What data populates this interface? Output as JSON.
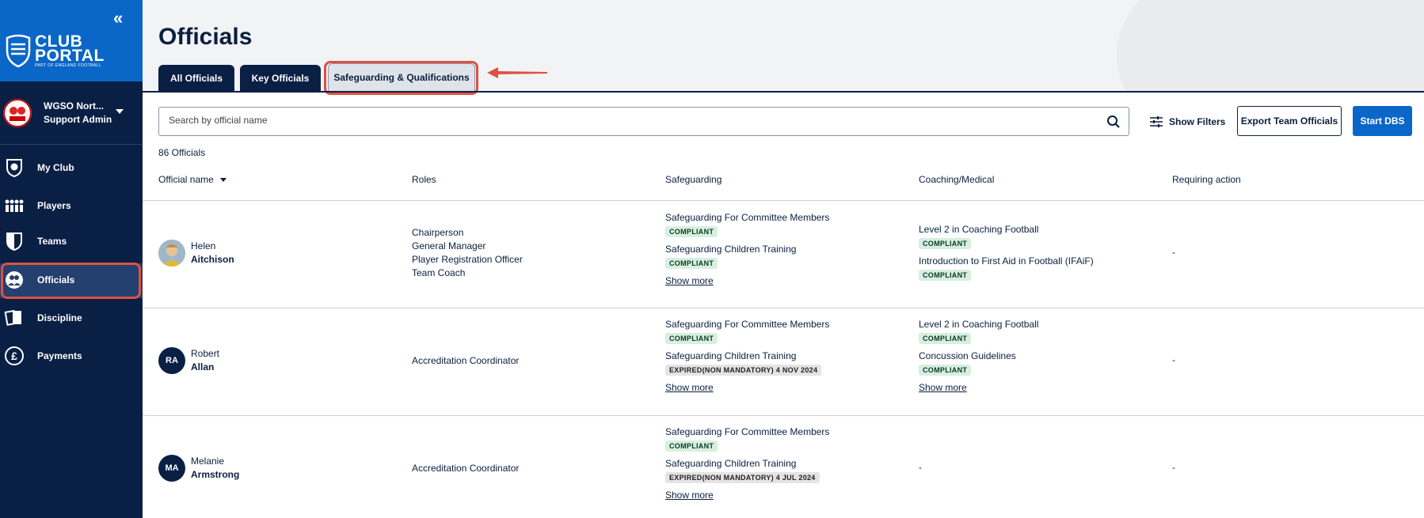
{
  "sidebar": {
    "collapse_label": "«",
    "brand_line1": "CLUB",
    "brand_line2": "PORTAL",
    "brand_sub": "PART OF ENGLAND FOOTBALL",
    "account_name": "WGSO Nort...",
    "account_role": "Support Admin",
    "items": [
      {
        "label": "My Club",
        "icon": "shield-ball-icon"
      },
      {
        "label": "Players",
        "icon": "players-icon"
      },
      {
        "label": "Teams",
        "icon": "team-shield-icon"
      },
      {
        "label": "Officials",
        "icon": "officials-icon",
        "active": true
      },
      {
        "label": "Discipline",
        "icon": "cards-icon"
      },
      {
        "label": "Payments",
        "icon": "pound-icon"
      }
    ]
  },
  "page": {
    "title": "Officials",
    "tabs": [
      "All Officials",
      "Key Officials",
      "Safeguarding & Qualifications"
    ],
    "active_tab": "Safeguarding & Qualifications",
    "search_placeholder": "Search by official name",
    "show_filters": "Show Filters",
    "export_label": "Export Team Officials",
    "dbs_label": "Start DBS",
    "count_label": "86 Officials"
  },
  "table": {
    "headers": [
      "Official name",
      "Roles",
      "Safeguarding",
      "Coaching/Medical",
      "Requiring action"
    ],
    "rows": [
      {
        "first": "Helen",
        "last": "Aitchison",
        "initials": "",
        "roles": [
          "Chairperson",
          "General Manager",
          "Player Registration Officer",
          "Team Coach"
        ],
        "safeguarding": [
          {
            "title": "Safeguarding For Committee Members",
            "status": "COMPLIANT"
          },
          {
            "title": "Safeguarding Children Training",
            "status": "COMPLIANT"
          }
        ],
        "safeguarding_more": "Show more",
        "coaching": [
          {
            "title": "Level 2 in Coaching Football",
            "status": "COMPLIANT"
          },
          {
            "title": "Introduction to First Aid in Football (IFAiF)",
            "status": "COMPLIANT"
          }
        ],
        "coaching_more": "",
        "requiring": "-"
      },
      {
        "first": "Robert",
        "last": "Allan",
        "initials": "RA",
        "roles": [
          "Accreditation Coordinator"
        ],
        "safeguarding": [
          {
            "title": "Safeguarding For Committee Members",
            "status": "COMPLIANT"
          },
          {
            "title": "Safeguarding Children Training",
            "status": "EXPIRED(NON MANDATORY) 4 NOV 2024"
          }
        ],
        "safeguarding_more": "Show more",
        "coaching": [
          {
            "title": "Level 2 in Coaching Football",
            "status": "COMPLIANT"
          },
          {
            "title": "Concussion Guidelines",
            "status": "COMPLIANT"
          }
        ],
        "coaching_more": "Show more",
        "requiring": "-"
      },
      {
        "first": "Melanie",
        "last": "Armstrong",
        "initials": "MA",
        "roles": [
          "Accreditation Coordinator"
        ],
        "safeguarding": [
          {
            "title": "Safeguarding For Committee Members",
            "status": "COMPLIANT"
          },
          {
            "title": "Safeguarding Children Training",
            "status": "EXPIRED(NON MANDATORY) 4 JUL 2024"
          }
        ],
        "safeguarding_more": "Show more",
        "coaching_dash": "-",
        "requiring": "-"
      }
    ]
  },
  "colors": {
    "navy": "#0a1f44",
    "brand_blue": "#0b67c7",
    "annotation_red": "#e05040",
    "compliant_bg": "#d7efe0"
  }
}
